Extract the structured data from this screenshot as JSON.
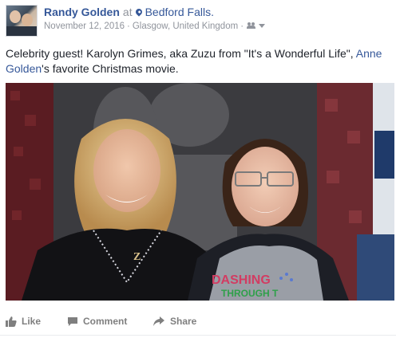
{
  "post": {
    "author": "Randy Golden",
    "at": "at",
    "place": "Bedford Falls.",
    "date": "November 12, 2016",
    "location": "Glasgow, United Kingdom",
    "separator": "·",
    "audience_icon": "friends-icon",
    "caption_part1": "Celebrity guest! Karolyn Grimes, aka Zuzu from \"It's a Wonderful Life\", ",
    "caption_link": "Anne Golden",
    "caption_part2": "'s favorite Christmas movie.",
    "photo_shirt_line1": "DASHING",
    "photo_shirt_line2": "THROUGH T"
  },
  "actions": {
    "like": "Like",
    "comment": "Comment",
    "share": "Share"
  },
  "colors": {
    "link": "#365899",
    "meta": "#90949c",
    "action": "#7f7f7f"
  }
}
